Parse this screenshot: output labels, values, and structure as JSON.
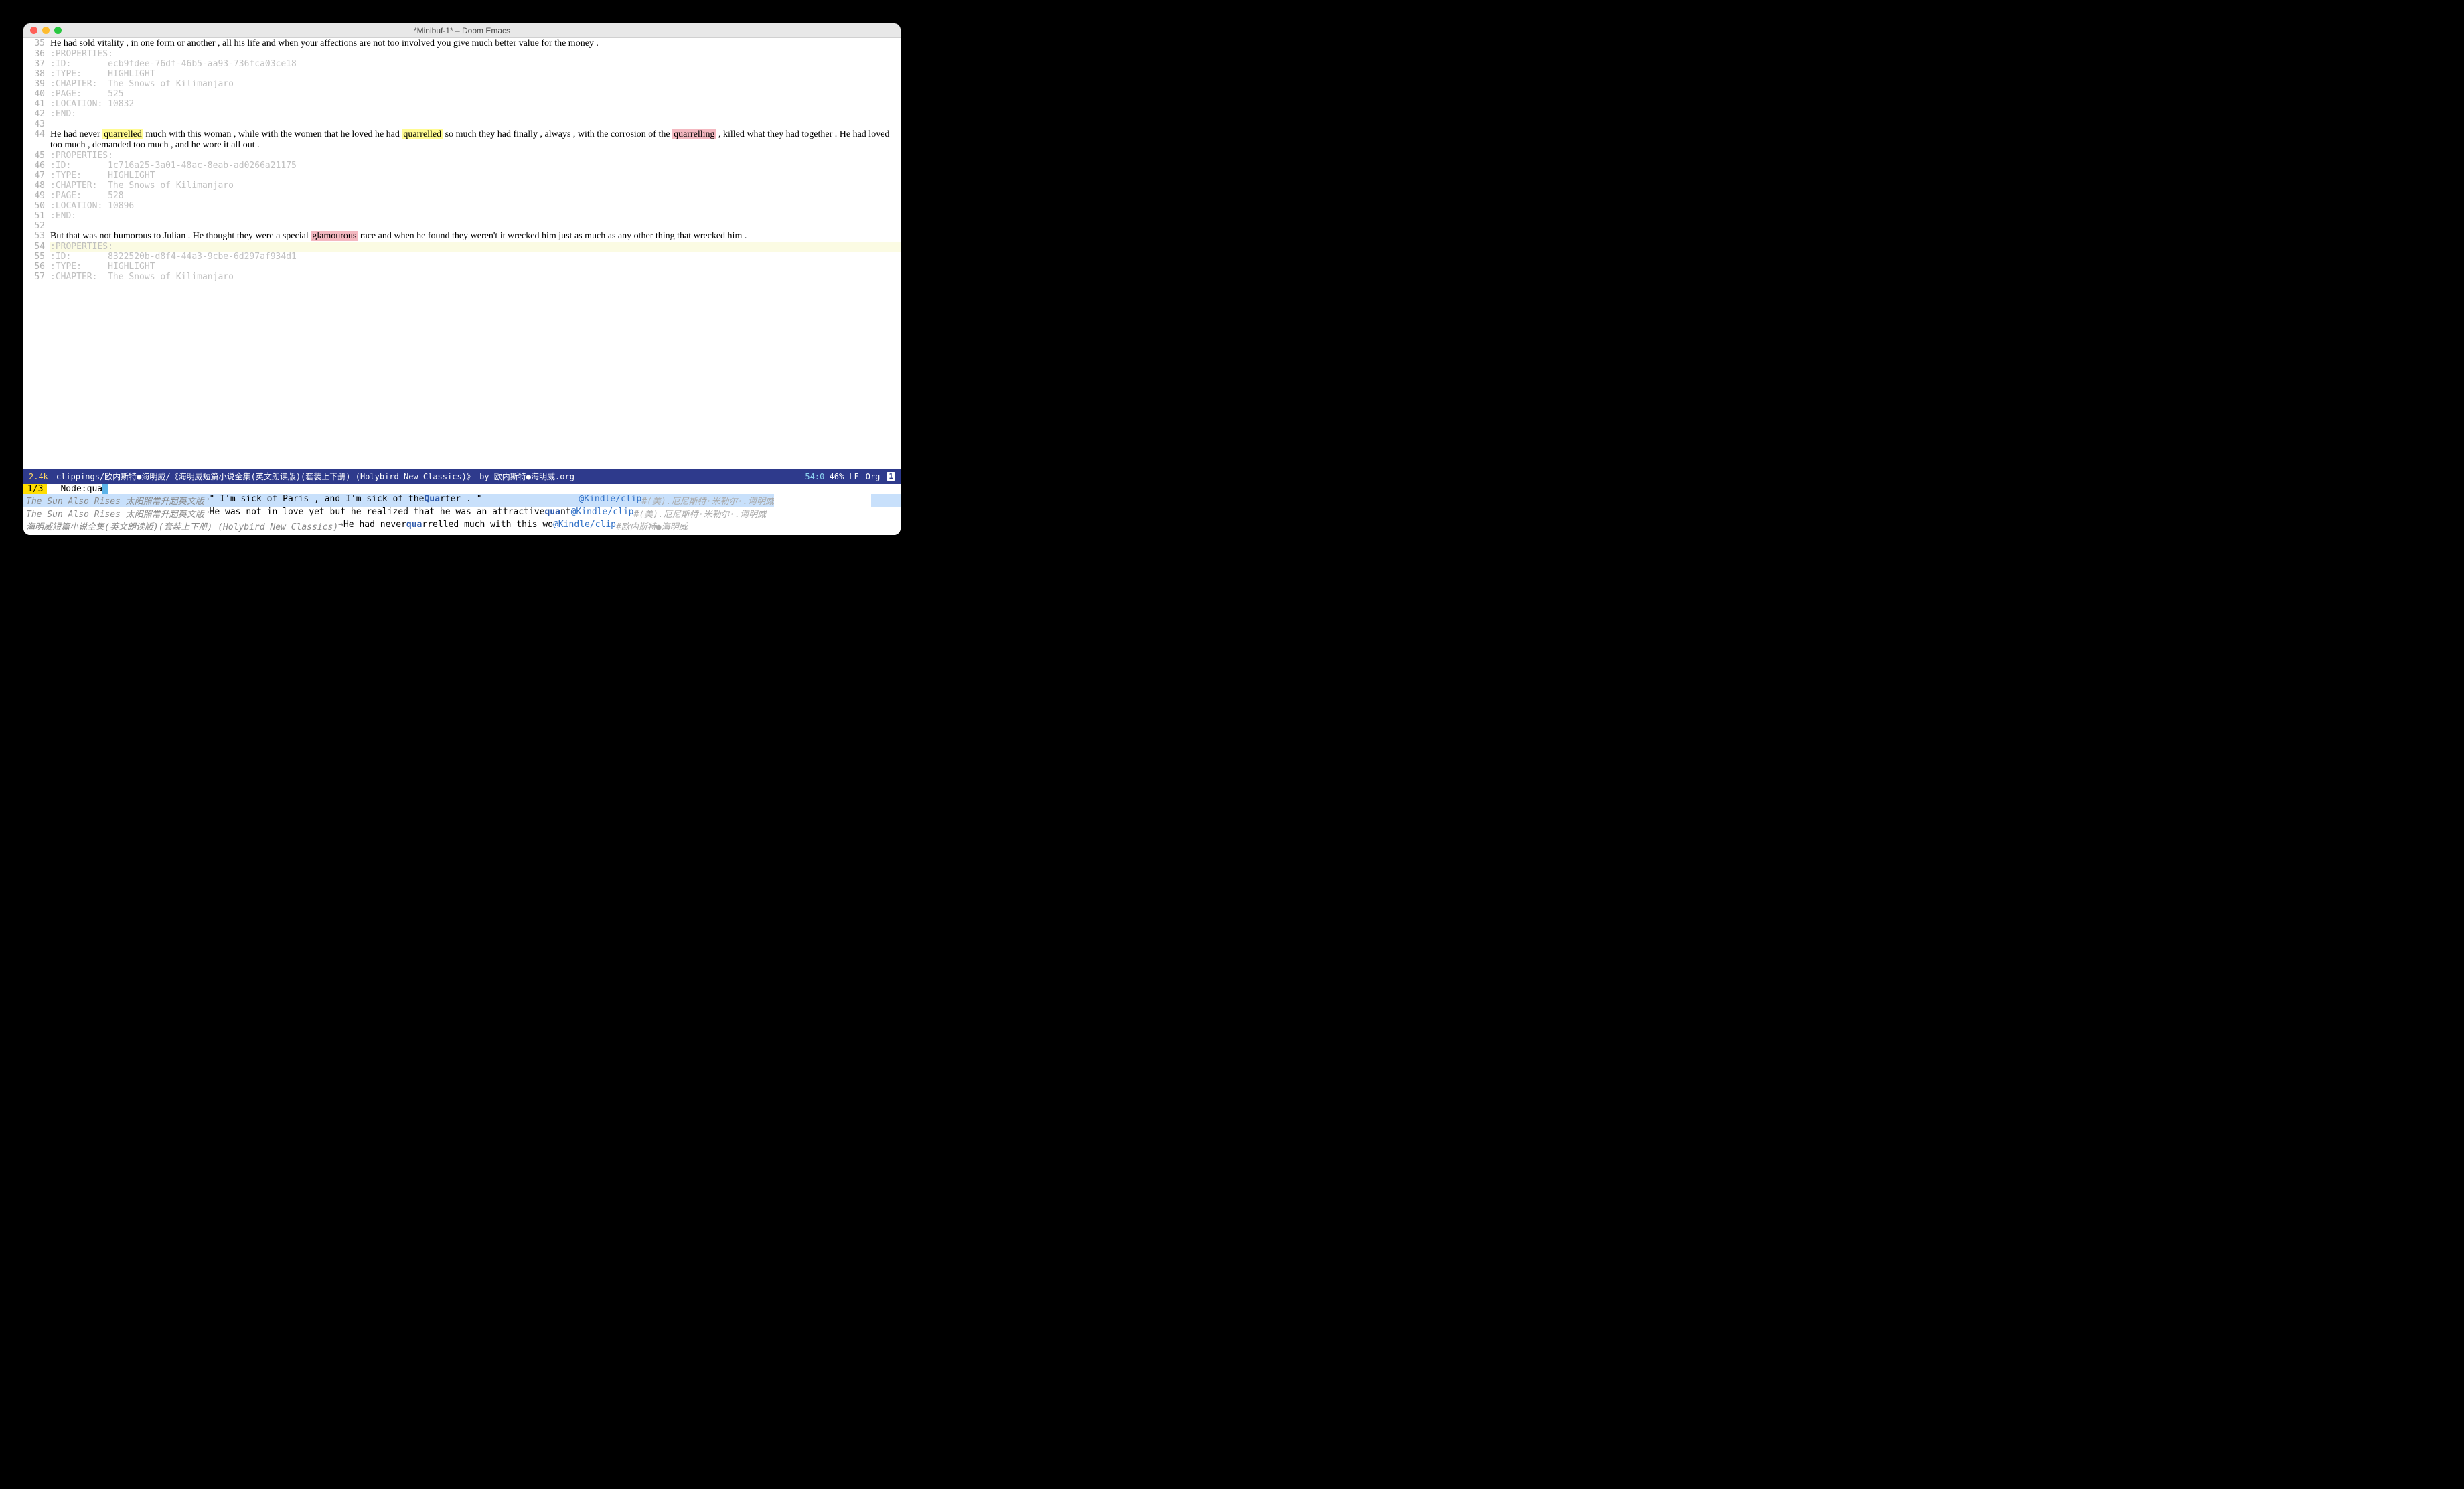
{
  "titlebar": {
    "title": "*Minibuf-1* – Doom Emacs"
  },
  "lines": [
    {
      "n": "35",
      "type": "serif",
      "parts": [
        {
          "t": "He had sold vitality , in one form or another , all his life and when your affections are not too involved you give much better value for the money ."
        }
      ]
    },
    {
      "n": "36",
      "type": "faded",
      "parts": [
        {
          "t": ":PROPERTIES:"
        }
      ]
    },
    {
      "n": "37",
      "type": "faded",
      "parts": [
        {
          "t": ":ID:       ecb9fdee-76df-46b5-aa93-736fca03ce18"
        }
      ]
    },
    {
      "n": "38",
      "type": "faded",
      "parts": [
        {
          "t": ":TYPE:     HIGHLIGHT"
        }
      ]
    },
    {
      "n": "39",
      "type": "faded",
      "parts": [
        {
          "t": ":CHAPTER:  The Snows of Kilimanjaro"
        }
      ]
    },
    {
      "n": "40",
      "type": "faded",
      "parts": [
        {
          "t": ":PAGE:     525"
        }
      ]
    },
    {
      "n": "41",
      "type": "faded",
      "parts": [
        {
          "t": ":LOCATION: 10832"
        }
      ]
    },
    {
      "n": "42",
      "type": "faded",
      "parts": [
        {
          "t": ":END:"
        }
      ]
    },
    {
      "n": "43",
      "type": "faded",
      "parts": [
        {
          "t": ""
        }
      ]
    },
    {
      "n": "44",
      "type": "serif",
      "parts": [
        {
          "t": "He had never "
        },
        {
          "t": "quarrelled",
          "hl": "yellow"
        },
        {
          "t": " much with this woman , while with the women that he loved he had "
        },
        {
          "t": "quarrelled",
          "hl": "yellow"
        },
        {
          "t": " so much they had finally , always , with the corrosion of the "
        },
        {
          "t": "quarrelling",
          "hl": "pink"
        },
        {
          "t": " , killed what they had together . He had loved too much , demanded too much , and he wore it all out ."
        }
      ]
    },
    {
      "n": "45",
      "type": "faded",
      "parts": [
        {
          "t": ":PROPERTIES:"
        }
      ]
    },
    {
      "n": "46",
      "type": "faded",
      "parts": [
        {
          "t": ":ID:       1c716a25-3a01-48ac-8eab-ad0266a21175"
        }
      ]
    },
    {
      "n": "47",
      "type": "faded",
      "parts": [
        {
          "t": ":TYPE:     HIGHLIGHT"
        }
      ]
    },
    {
      "n": "48",
      "type": "faded",
      "parts": [
        {
          "t": ":CHAPTER:  The Snows of Kilimanjaro"
        }
      ]
    },
    {
      "n": "49",
      "type": "faded",
      "parts": [
        {
          "t": ":PAGE:     528"
        }
      ]
    },
    {
      "n": "50",
      "type": "faded",
      "parts": [
        {
          "t": ":LOCATION: 10896"
        }
      ]
    },
    {
      "n": "51",
      "type": "faded",
      "parts": [
        {
          "t": ":END:"
        }
      ]
    },
    {
      "n": "52",
      "type": "faded",
      "parts": [
        {
          "t": ""
        }
      ]
    },
    {
      "n": "53",
      "type": "serif",
      "parts": [
        {
          "t": "But that was not humorous to Julian . He thought they were a special "
        },
        {
          "t": "glamourous",
          "hl": "pink"
        },
        {
          "t": " race and when he found they weren't it wrecked him just as much as any other thing that wrecked him ."
        }
      ]
    },
    {
      "n": "54",
      "type": "faded",
      "hl": true,
      "parts": [
        {
          "t": ":PROPERTIES:"
        }
      ]
    },
    {
      "n": "55",
      "type": "faded",
      "parts": [
        {
          "t": ":ID:       8322520b-d8f4-44a3-9cbe-6d297af934d1"
        }
      ]
    },
    {
      "n": "56",
      "type": "faded",
      "parts": [
        {
          "t": ":TYPE:     HIGHLIGHT"
        }
      ]
    },
    {
      "n": "57",
      "type": "faded",
      "parts": [
        {
          "t": ":CHAPTER:  The Snows of Kilimanjaro"
        }
      ]
    }
  ],
  "modeline": {
    "size": "2.4k",
    "path": "clippings/欧内斯特●海明威/《海明威短篇小说全集(英文朗读版)(套装上下册) (Holybird New Classics)》 by 欧内斯特●海明威.org",
    "pos": "54:0",
    "pct": "46%",
    "eol": "LF",
    "mode": "Org",
    "badge": "1"
  },
  "minibuf": {
    "count": "1/3",
    "label": "Node: ",
    "input": "qua",
    "results": [
      {
        "selected": true,
        "source": "The Sun Also Rises 太阳照常升起英文版",
        "arrow": "→",
        "pre": "\" I'm sick of Paris , and I'm sick of the ",
        "match": "Qua",
        "post": "rter . \"",
        "tag": "@Kindle/clip",
        "meta": "#(美).厄尼斯特·米勒尔·.海明威"
      },
      {
        "source": "The Sun Also Rises 太阳照常升起英文版",
        "arrow": "→",
        "pre": "He was not in love yet but he realized that he was an attractive ",
        "match": "qua",
        "post": "nt ",
        "tag": "@Kindle/clip",
        "meta": "#(美).厄尼斯特·米勒尔·.海明威"
      },
      {
        "source": "海明威短篇小说全集(英文朗读版)(套装上下册) (Holybird New Classics)",
        "arrow": "→",
        "pre": "He had never ",
        "match": "qua",
        "post": "rrelled much with this wo ",
        "tag": "@Kindle/clip",
        "meta": "#欧内斯特●海明威"
      }
    ]
  }
}
